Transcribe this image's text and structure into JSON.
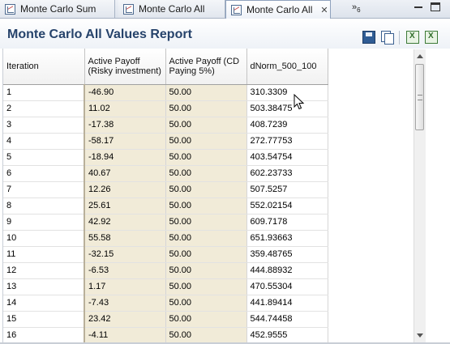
{
  "tabs": [
    {
      "label": "Monte Carlo Sum",
      "active": false
    },
    {
      "label": "Monte Carlo All",
      "active": false
    },
    {
      "label": "Monte Carlo All",
      "active": true,
      "close": "✕"
    }
  ],
  "overflow": {
    "label": "»",
    "count": "6"
  },
  "report": {
    "title": "Monte Carlo All Values Report"
  },
  "toolbar_icons": [
    "save-icon",
    "copy-icon",
    "export-excel-icon",
    "export-excel-all-icon"
  ],
  "table": {
    "headers": [
      "Iteration",
      "Active Payoff (Risky investment)",
      "Active Payoff (CD Paying 5%)",
      "dNorm_500_100"
    ],
    "rows": [
      [
        "1",
        "-46.90",
        "50.00",
        "310.3309"
      ],
      [
        "2",
        "11.02",
        "50.00",
        "503.38475"
      ],
      [
        "3",
        "-17.38",
        "50.00",
        "408.7239"
      ],
      [
        "4",
        "-58.17",
        "50.00",
        "272.77753"
      ],
      [
        "5",
        "-18.94",
        "50.00",
        "403.54754"
      ],
      [
        "6",
        "40.67",
        "50.00",
        "602.23733"
      ],
      [
        "7",
        "12.26",
        "50.00",
        "507.5257"
      ],
      [
        "8",
        "25.61",
        "50.00",
        "552.02154"
      ],
      [
        "9",
        "42.92",
        "50.00",
        "609.7178"
      ],
      [
        "10",
        "55.58",
        "50.00",
        "651.93663"
      ],
      [
        "11",
        "-32.15",
        "50.00",
        "359.48765"
      ],
      [
        "12",
        "-6.53",
        "50.00",
        "444.88932"
      ],
      [
        "13",
        "1.17",
        "50.00",
        "470.55304"
      ],
      [
        "14",
        "-7.43",
        "50.00",
        "441.89414"
      ],
      [
        "15",
        "23.42",
        "50.00",
        "544.74458"
      ],
      [
        "16",
        "-4.11",
        "50.00",
        "452.9555"
      ]
    ]
  },
  "colors": {
    "title": "#26436b",
    "shade": "#f1ebd8"
  }
}
